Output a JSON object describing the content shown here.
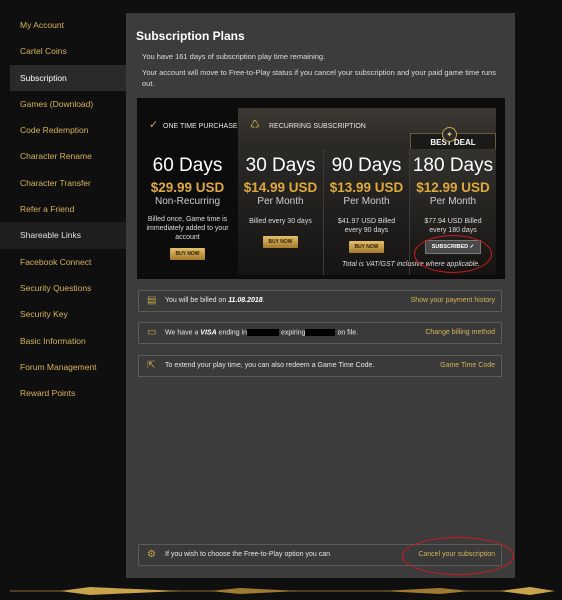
{
  "sidebar": {
    "items": [
      {
        "label": "My Account"
      },
      {
        "label": "Cartel Coins"
      },
      {
        "label": "Subscription"
      },
      {
        "label": "Games (Download)"
      },
      {
        "label": "Code Redemption"
      },
      {
        "label": "Character Rename"
      },
      {
        "label": "Character Transfer"
      },
      {
        "label": "Refer a Friend"
      },
      {
        "label": "Shareable Links"
      },
      {
        "label": "Facebook Connect"
      },
      {
        "label": "Security Questions"
      },
      {
        "label": "Security Key"
      },
      {
        "label": "Basic Information"
      },
      {
        "label": "Forum Management"
      },
      {
        "label": "Reward Points"
      }
    ]
  },
  "main": {
    "title": "Subscription Plans",
    "remaining": "You have 161 days of subscription play time remaining.",
    "notice": "Your account will move to Free-to-Play status if you cancel your subscription and your paid game time runs out."
  },
  "plans": {
    "one_time_label": "ONE TIME PURCHASE",
    "recurring_label": "RECURRING SUBSCRIPTION",
    "best_deal_label": "BEST DEAL",
    "vat_note": "Total is VAT/GST inclusive where applicable.",
    "items": [
      {
        "days": "60 Days",
        "price": "$29.99 USD",
        "period": "Non-Recurring",
        "billed": "Billed once, Game time is immediately added to your account",
        "button": "BUY NOW"
      },
      {
        "days": "30 Days",
        "price": "$14.99 USD",
        "period": "Per Month",
        "billed": "Billed every 30 days",
        "button": "BUY NOW"
      },
      {
        "days": "90 Days",
        "price": "$13.99 USD",
        "period": "Per Month",
        "billed": "$41.97 USD Billed every 90 days",
        "button": "BUY NOW"
      },
      {
        "days": "180 Days",
        "price": "$12.99 USD",
        "period": "Per Month",
        "billed": "$77.94 USD Billed every 180 days",
        "button": "SUBSCRIBED ✓"
      }
    ]
  },
  "billing": {
    "billed_prefix": "You will be billed on",
    "billed_date": "11.08.2018",
    "billed_suffix": ".",
    "history_link": "Show your payment history",
    "card_prefix": "We have a",
    "card_brand": "VISA",
    "card_mid1": "ending in",
    "card_mid2": "expiring",
    "card_suffix": "on file.",
    "change_link": "Change billing method",
    "gtc_text": "To extend your play time, you can also redeem a Game Time Code.",
    "gtc_link": "Game Time Code",
    "ftp_text": "If you wish to choose the Free-to-Play option you can",
    "cancel_link": "Cancel your subscription"
  },
  "colors": {
    "accent": "#d8b25a",
    "price": "#e0a93b",
    "annotation": "#d21a1a"
  }
}
